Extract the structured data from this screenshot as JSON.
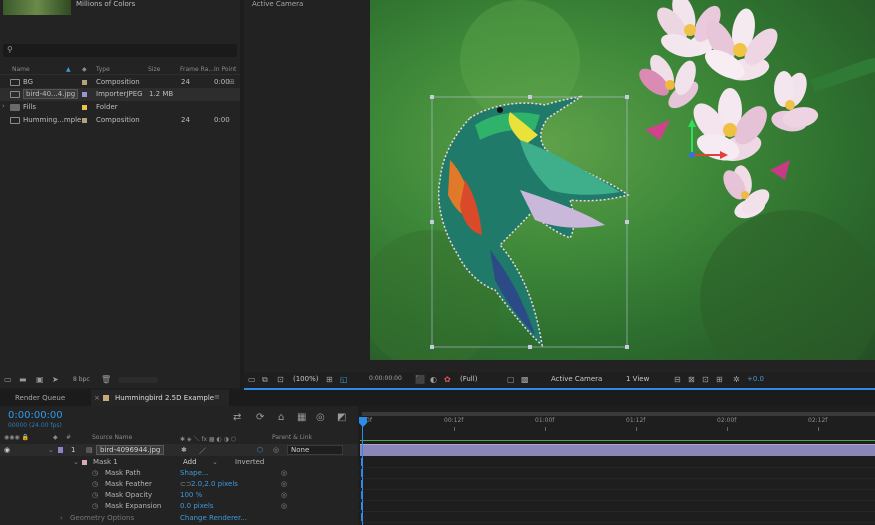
{
  "project": {
    "thumbnail_desc": "Millions of Colors",
    "columns": [
      "Name",
      "Type",
      "Size",
      "Frame Ra...",
      "In Point"
    ],
    "items": [
      {
        "name": "BG",
        "type": "Composition",
        "size": "",
        "fps": "24",
        "inpoint": "0:00",
        "color": "#b5a17a"
      },
      {
        "name": "bird-40...4.jpg",
        "type": "ImporterJPEG",
        "size": "1.2 MB",
        "fps": "",
        "inpoint": "",
        "color": "#9a93d4"
      },
      {
        "name": "Fills",
        "type": "Folder",
        "size": "",
        "fps": "",
        "inpoint": "",
        "color": "#e8c547"
      },
      {
        "name": "Humming...mple",
        "type": "Composition",
        "size": "",
        "fps": "24",
        "inpoint": "0:00",
        "color": "#b5a17a"
      }
    ],
    "bpc": "8 bpc"
  },
  "viewer": {
    "camera_label": "Active Camera",
    "zoom": "(100%)",
    "time": "0:00:00:00",
    "resolution": "(Full)",
    "camera": "Active Camera",
    "views": "1 View",
    "exposure": "+0.0"
  },
  "timeline": {
    "tab_render_queue": "Render Queue",
    "tab_comp": "Hummingbird 2.5D Example",
    "timecode": "0:00:00:00",
    "fps": "00000 (24.00 fps)",
    "col_source": "Source Name",
    "col_parent": "Parent & Link",
    "layer": {
      "index": "1",
      "name": "bird-4096944.jpg",
      "parent": "None"
    },
    "mask": {
      "name": "Mask 1",
      "mode": "Add",
      "inverted": "Inverted"
    },
    "props": [
      {
        "label": "Mask Path",
        "value": "Shape..."
      },
      {
        "label": "Mask Feather",
        "value": "2.0,2.0 pixels"
      },
      {
        "label": "Mask Opacity",
        "value": "100 %"
      },
      {
        "label": "Mask Expansion",
        "value": "0.0 pixels"
      }
    ],
    "geometry": {
      "label": "Geometry Options",
      "value": "Change Renderer..."
    },
    "ruler": [
      "0f",
      "00:12f",
      "01:00f",
      "01:12f",
      "02:00f",
      "02:12f"
    ]
  },
  "colors": {
    "accent": "#2d8ceb",
    "timecode": "#2d9bf0",
    "layer_bar": "#8a86b8"
  }
}
